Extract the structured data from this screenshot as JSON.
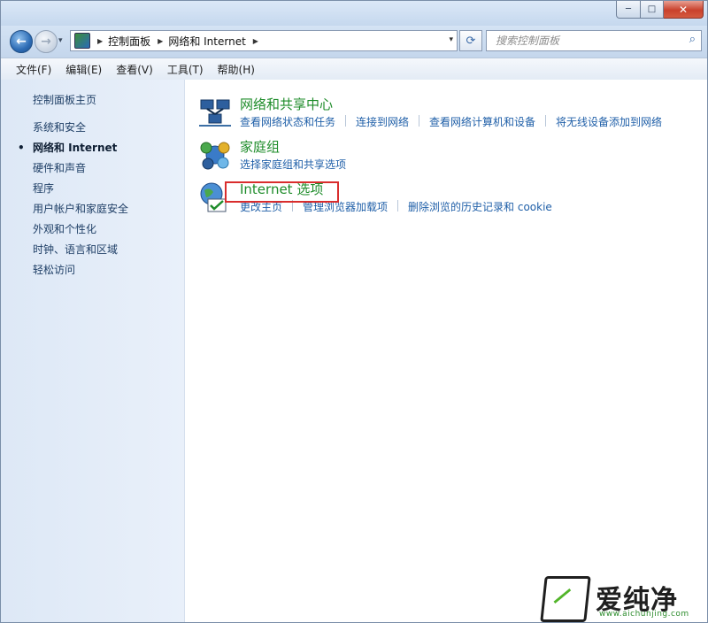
{
  "window": {
    "caption_buttons": {
      "minimize": "─",
      "maximize": "□",
      "close": "✕"
    }
  },
  "nav": {
    "back_icon": "←",
    "forward_icon": "→",
    "dropdown_icon": "▾"
  },
  "address": {
    "breadcrumbs": [
      "控制面板",
      "网络和 Internet"
    ],
    "separator": "▶",
    "dropdown_icon": "▾"
  },
  "refresh_icon": "⟳",
  "search": {
    "placeholder": "搜索控制面板",
    "icon": "⌕"
  },
  "menubar": {
    "items": [
      "文件(F)",
      "编辑(E)",
      "查看(V)",
      "工具(T)",
      "帮助(H)"
    ]
  },
  "sidebar": {
    "home": "控制面板主页",
    "items": [
      {
        "label": "系统和安全"
      },
      {
        "label": "网络和 Internet",
        "current": true
      },
      {
        "label": "硬件和声音"
      },
      {
        "label": "程序"
      },
      {
        "label": "用户帐户和家庭安全"
      },
      {
        "label": "外观和个性化"
      },
      {
        "label": "时钟、语言和区域"
      },
      {
        "label": "轻松访问"
      }
    ],
    "bullet": "•"
  },
  "categories": [
    {
      "title": "网络和共享中心",
      "icon": "network-sharing-icon",
      "links": [
        "查看网络状态和任务",
        "连接到网络",
        "查看网络计算机和设备",
        "将无线设备添加到网络"
      ]
    },
    {
      "title": "家庭组",
      "icon": "homegroup-icon",
      "links": [
        "选择家庭组和共享选项"
      ]
    },
    {
      "title": "Internet 选项",
      "icon": "internet-options-icon",
      "links": [
        "更改主页",
        "管理浏览器加载项",
        "删除浏览的历史记录和 cookie"
      ]
    }
  ],
  "watermark": {
    "text": "爱纯净",
    "url": "www.aichunjing.com"
  },
  "colors": {
    "category_title": "#1e8c2a",
    "link": "#1f5fa8",
    "highlight": "#d92d2d"
  }
}
